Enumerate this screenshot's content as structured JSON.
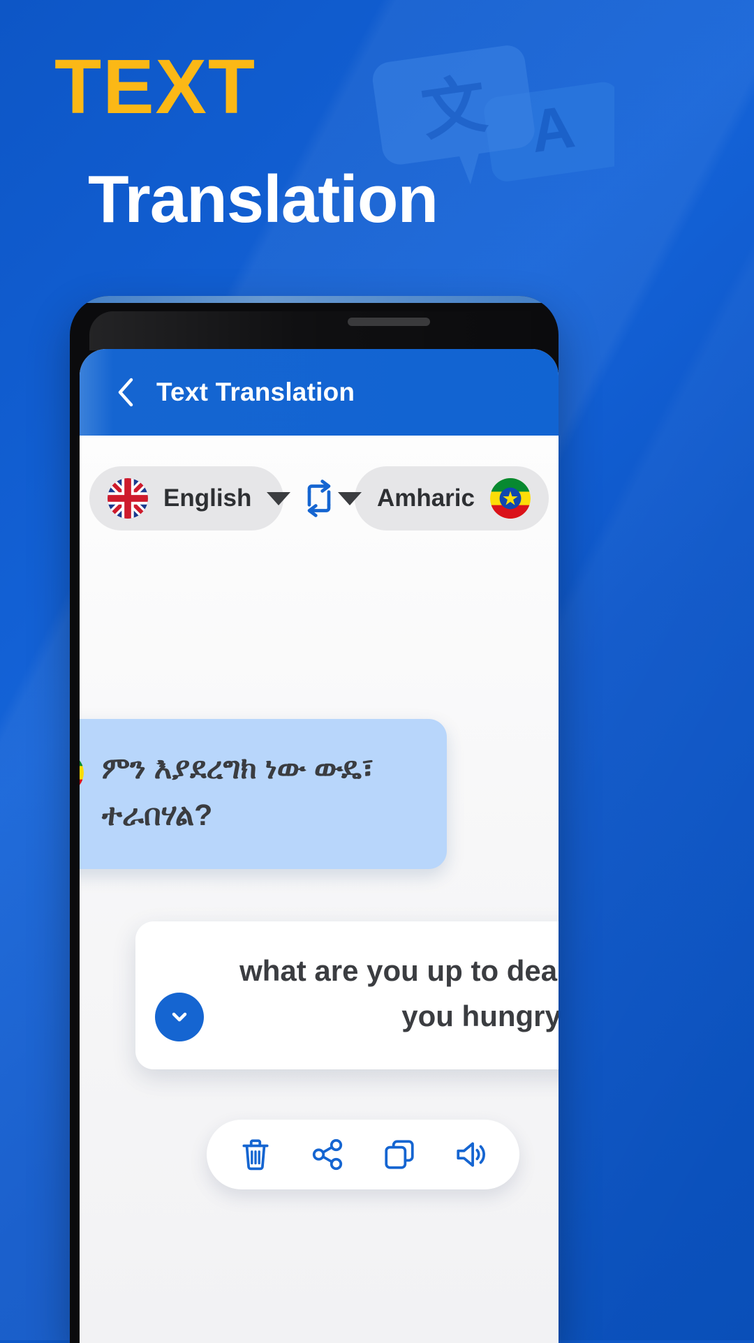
{
  "promo": {
    "heading_line1": "TEXT",
    "heading_line2": "Translation",
    "accent_color": "#FBB816",
    "background_color": "#0E58C8",
    "watermark_glyph_cjk": "文",
    "watermark_glyph_latin": "A"
  },
  "app": {
    "appbar": {
      "back_icon": "chevron-left-icon",
      "title": "Text Translation"
    },
    "language_selector": {
      "source": {
        "label": "English",
        "flag": "uk-flag-icon",
        "caret": "chevron-down-icon"
      },
      "swap_icon": "swap-languages-icon",
      "target": {
        "label": "Amharic",
        "flag": "ethiopia-flag-icon",
        "caret": "chevron-down-icon"
      }
    },
    "messages": [
      {
        "role": "source",
        "language": "Amharic",
        "flag": "ethiopia-flag-icon",
        "text": "ምን እያደረግክ ነው ውዴ፣ ተራበሃል?"
      },
      {
        "role": "translation",
        "language": "English",
        "flag": "uk-flag-icon",
        "text": "what are you up to dear, Are you hungry?",
        "expand_icon": "chevron-down-circle-icon"
      }
    ],
    "actions": [
      {
        "name": "delete",
        "icon": "trash-icon"
      },
      {
        "name": "share",
        "icon": "share-icon"
      },
      {
        "name": "copy",
        "icon": "copy-icon"
      },
      {
        "name": "speak",
        "icon": "speaker-icon"
      }
    ],
    "accent_color": "#1565D1"
  }
}
